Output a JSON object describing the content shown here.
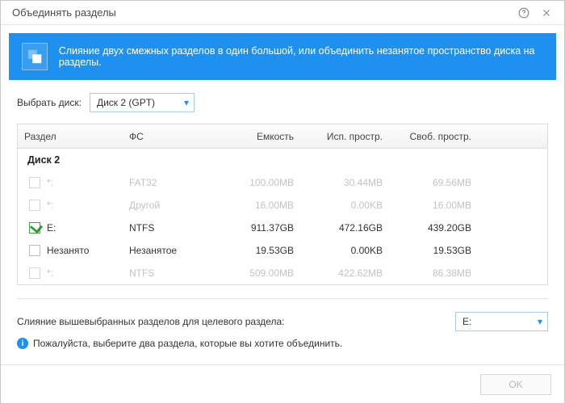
{
  "title": "Объединять разделы",
  "banner": "Слияние двух смежных разделов в один большой, или объединить незанятое пространство диска на разделы.",
  "selectDiskLabel": "Выбрать диск:",
  "selectDiskValue": "Диск 2 (GPT)",
  "columns": {
    "partition": "Раздел",
    "fs": "ФС",
    "capacity": "Емкость",
    "used": "Исп. простр.",
    "free": "Своб. простр."
  },
  "groupLabel": "Диск 2",
  "rows": [
    {
      "checked": false,
      "dim": true,
      "part": "*:",
      "fs": "FAT32",
      "cap": "100.00MB",
      "used": "30.44MB",
      "free": "69.56MB"
    },
    {
      "checked": false,
      "dim": true,
      "part": "*:",
      "fs": "Другой",
      "cap": "16.00MB",
      "used": "0.00KB",
      "free": "16.00MB"
    },
    {
      "checked": true,
      "dim": false,
      "part": "E:",
      "fs": "NTFS",
      "cap": "911.37GB",
      "used": "472.16GB",
      "free": "439.20GB"
    },
    {
      "checked": false,
      "dim": false,
      "part": "Незанято",
      "fs": "Незанятое",
      "cap": "19.53GB",
      "used": "0.00KB",
      "free": "19.53GB"
    },
    {
      "checked": false,
      "dim": true,
      "part": "*:",
      "fs": "NTFS",
      "cap": "509.00MB",
      "used": "422.62MB",
      "free": "86.38MB"
    }
  ],
  "targetLabel": "Слияние вышевыбранных разделов для целевого раздела:",
  "targetValue": "E:",
  "hint": "Пожалуйста, выберите два раздела, которые вы хотите объединить.",
  "okLabel": "OK"
}
